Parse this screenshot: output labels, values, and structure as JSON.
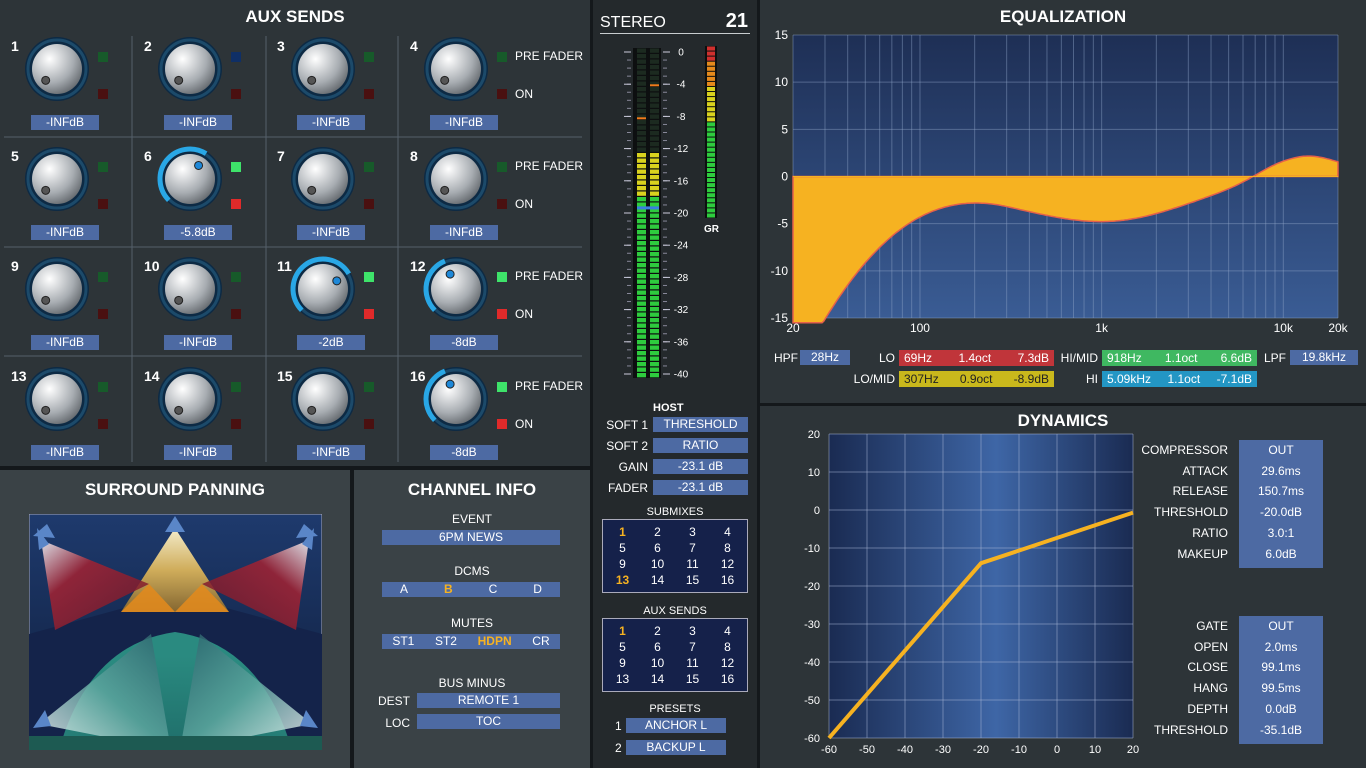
{
  "aux": {
    "title": "AUX SENDS",
    "pre_fader": "PRE FADER",
    "on": "ON",
    "channels": [
      {
        "n": "1",
        "val": "-INFdB",
        "level": 0,
        "pre": false,
        "on": false
      },
      {
        "n": "2",
        "val": "-INFdB",
        "level": 0,
        "pre": false,
        "on": false
      },
      {
        "n": "3",
        "val": "-INFdB",
        "level": 0,
        "pre": false,
        "on": false
      },
      {
        "n": "4",
        "val": "-INFdB",
        "level": 0,
        "pre": false,
        "on": false
      },
      {
        "n": "5",
        "val": "-INFdB",
        "level": 0,
        "pre": false,
        "on": false
      },
      {
        "n": "6",
        "val": "-5.8dB",
        "level": 0.62,
        "pre": true,
        "on": true
      },
      {
        "n": "7",
        "val": "-INFdB",
        "level": 0,
        "pre": false,
        "on": false
      },
      {
        "n": "8",
        "val": "-INFdB",
        "level": 0,
        "pre": false,
        "on": false
      },
      {
        "n": "9",
        "val": "-INFdB",
        "level": 0,
        "pre": false,
        "on": false
      },
      {
        "n": "10",
        "val": "-INFdB",
        "level": 0,
        "pre": false,
        "on": false
      },
      {
        "n": "11",
        "val": "-2dB",
        "level": 0.72,
        "pre": true,
        "on": true
      },
      {
        "n": "12",
        "val": "-8dB",
        "level": 0.42,
        "pre": true,
        "on": true
      },
      {
        "n": "13",
        "val": "-INFdB",
        "level": 0,
        "pre": false,
        "on": false
      },
      {
        "n": "14",
        "val": "-INFdB",
        "level": 0,
        "pre": false,
        "on": false
      },
      {
        "n": "15",
        "val": "-INFdB",
        "level": 0,
        "pre": false,
        "on": false
      },
      {
        "n": "16",
        "val": "-8dB",
        "level": 0.42,
        "pre": true,
        "on": true
      }
    ]
  },
  "surround": {
    "title": "SURROUND PANNING"
  },
  "info": {
    "title": "CHANNEL INFO",
    "event_label": "EVENT",
    "event": "6PM NEWS",
    "dcms_label": "DCMS",
    "dcms": [
      "A",
      "B",
      "C",
      "D"
    ],
    "dcms_active": "B",
    "mutes_label": "MUTES",
    "mutes": [
      "ST1",
      "ST2",
      "HDPN",
      "CR"
    ],
    "mutes_active": "HDPN",
    "bus_label": "BUS MINUS",
    "dest_label": "DEST",
    "dest": "REMOTE 1",
    "loc_label": "LOC",
    "loc": "TOC"
  },
  "stereo": {
    "title": "STEREO",
    "channel": "21",
    "scale": [
      "0",
      "-4",
      "-8",
      "-12",
      "-16",
      "-20",
      "-24",
      "-28",
      "-32",
      "-36",
      "-40"
    ],
    "gr": "GR",
    "meter_l": 0.67,
    "meter_r": 0.67,
    "peak_l": 0.79,
    "peak_r": 0.89,
    "gr_level": 0.5,
    "host": {
      "title": "HOST",
      "rows": [
        {
          "label": "SOFT 1",
          "value": "THRESHOLD"
        },
        {
          "label": "SOFT 2",
          "value": "RATIO"
        },
        {
          "label": "GAIN",
          "value": "-23.1 dB"
        },
        {
          "label": "FADER",
          "value": "-23.1 dB"
        }
      ]
    },
    "submixes": {
      "title": "SUBMIXES",
      "items": [
        "1",
        "2",
        "3",
        "4",
        "5",
        "6",
        "7",
        "8",
        "9",
        "10",
        "11",
        "12",
        "13",
        "14",
        "15",
        "16"
      ],
      "active": [
        "1",
        "13"
      ]
    },
    "auxsends": {
      "title": "AUX SENDS",
      "items": [
        "1",
        "2",
        "3",
        "4",
        "5",
        "6",
        "7",
        "8",
        "9",
        "10",
        "11",
        "12",
        "13",
        "14",
        "15",
        "16"
      ],
      "active": [
        "1"
      ]
    },
    "presets": {
      "title": "PRESETS",
      "items": [
        {
          "n": "1",
          "label": "ANCHOR L"
        },
        {
          "n": "2",
          "label": "BACKUP L"
        }
      ]
    }
  },
  "eq": {
    "title": "EQUALIZATION",
    "y_ticks": [
      "15",
      "10",
      "5",
      "0",
      "-5",
      "-10",
      "-15"
    ],
    "x_ticks": [
      "20",
      "100",
      "1k",
      "10k",
      "20k"
    ],
    "hpf_label": "HPF",
    "hpf": "28Hz",
    "lpf_label": "LPF",
    "lpf": "19.8kHz",
    "bands": [
      {
        "label": "LO",
        "freq": "69Hz",
        "q": "1.4oct",
        "gain": "7.3dB",
        "color": "#c0353a"
      },
      {
        "label": "LO/MID",
        "freq": "307Hz",
        "q": "0.9oct",
        "gain": "-8.9dB",
        "color": "#c9b81c"
      },
      {
        "label": "HI/MID",
        "freq": "918Hz",
        "q": "1.1oct",
        "gain": "6.6dB",
        "color": "#3fb861"
      },
      {
        "label": "HI",
        "freq": "5.09kHz",
        "q": "1.1oct",
        "gain": "-7.1dB",
        "color": "#2396c4"
      }
    ]
  },
  "dyn": {
    "title": "DYNAMICS",
    "y_ticks": [
      "20",
      "10",
      "0",
      "-10",
      "-20",
      "-30",
      "-40",
      "-50",
      "-60"
    ],
    "x_ticks": [
      "-60",
      "-50",
      "-40",
      "-30",
      "-20",
      "-10",
      "0",
      "10",
      "20"
    ],
    "compressor": [
      {
        "label": "COMPRESSOR",
        "value": "OUT"
      },
      {
        "label": "ATTACK",
        "value": "29.6ms"
      },
      {
        "label": "RELEASE",
        "value": "150.7ms"
      },
      {
        "label": "THRESHOLD",
        "value": "-20.0dB"
      },
      {
        "label": "RATIO",
        "value": "3.0:1"
      },
      {
        "label": "MAKEUP",
        "value": "6.0dB"
      }
    ],
    "gate": [
      {
        "label": "GATE",
        "value": "OUT"
      },
      {
        "label": "OPEN",
        "value": "2.0ms"
      },
      {
        "label": "CLOSE",
        "value": "99.1ms"
      },
      {
        "label": "HANG",
        "value": "99.5ms"
      },
      {
        "label": "DEPTH",
        "value": "0.0dB"
      },
      {
        "label": "THRESHOLD",
        "value": "-35.1dB"
      }
    ]
  },
  "colors": {
    "accent": "#f6b221",
    "value_box": "#4d6aa3",
    "led_on": "#3ee36a",
    "led_red": "#e02a2a"
  }
}
